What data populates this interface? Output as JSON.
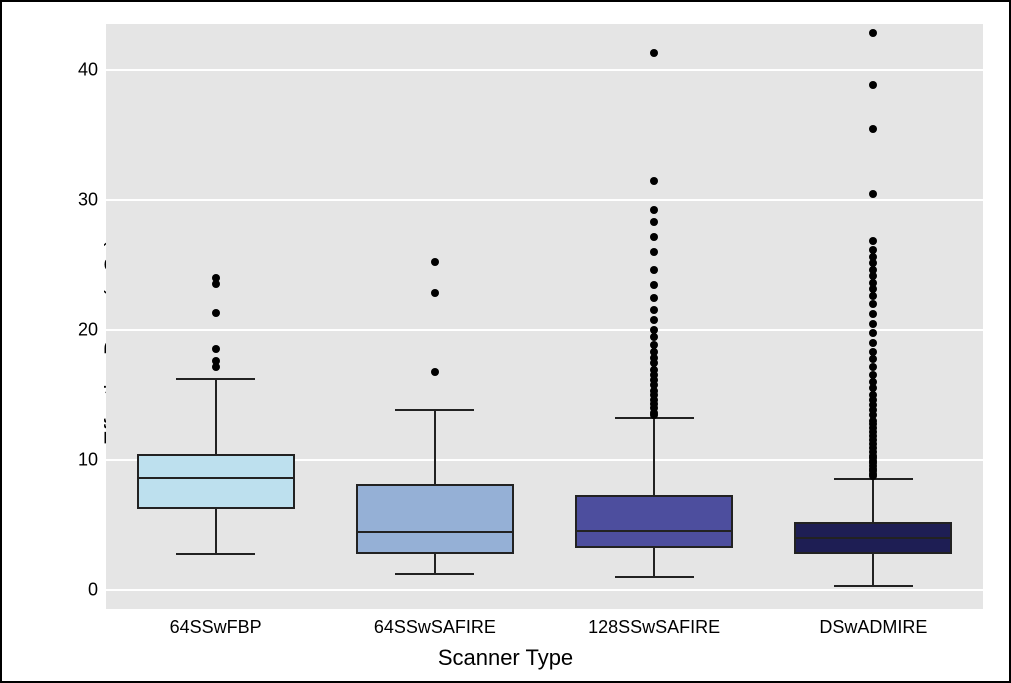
{
  "chart_data": {
    "type": "box",
    "xlabel": "Scanner Type",
    "ylabel": "Effective Dose (mSv)",
    "ylim": [
      -1.5,
      43.5
    ],
    "yticks": [
      0,
      10,
      20,
      30,
      40
    ],
    "categories": [
      "64SSwFBP",
      "64SSwSAFIRE",
      "128SSwSAFIRE",
      "DSwADMIRE"
    ],
    "box_half_width_frac": 0.09,
    "fills": [
      "#bde0ee",
      "#95b0d6",
      "#4d4e9e",
      "#1e1e54"
    ],
    "series": [
      {
        "name": "64SSwFBP",
        "q1": 6.2,
        "median": 8.6,
        "q3": 10.4,
        "whisker_low": 2.7,
        "whisker_high": 16.2,
        "outliers": [
          17.1,
          17.6,
          18.5,
          21.3,
          23.5,
          24.0
        ]
      },
      {
        "name": "64SSwSAFIRE",
        "q1": 2.7,
        "median": 4.4,
        "q3": 8.1,
        "whisker_low": 1.2,
        "whisker_high": 13.8,
        "outliers": [
          16.7,
          22.8,
          25.2
        ]
      },
      {
        "name": "128SSwSAFIRE",
        "q1": 3.2,
        "median": 4.5,
        "q3": 7.3,
        "whisker_low": 1.0,
        "whisker_high": 13.2,
        "outliers": [
          13.4,
          13.6,
          14.0,
          14.3,
          14.6,
          15.0,
          15.3,
          15.7,
          16.1,
          16.5,
          16.9,
          17.4,
          17.8,
          18.3,
          18.8,
          19.4,
          20.0,
          20.7,
          21.5,
          22.4,
          23.4,
          24.6,
          26.0,
          27.1,
          28.3,
          29.2,
          31.4,
          41.3
        ]
      },
      {
        "name": "DSwADMIRE",
        "q1": 2.7,
        "median": 4.0,
        "q3": 5.2,
        "whisker_low": 0.3,
        "whisker_high": 8.5,
        "outliers": [
          8.7,
          8.9,
          9.1,
          9.3,
          9.5,
          9.7,
          9.9,
          10.1,
          10.3,
          10.6,
          10.9,
          11.2,
          11.5,
          11.8,
          12.1,
          12.4,
          12.7,
          13.0,
          13.4,
          13.8,
          14.2,
          14.6,
          15.0,
          15.5,
          16.0,
          16.5,
          17.1,
          17.7,
          18.3,
          19.0,
          19.7,
          20.4,
          21.2,
          22.0,
          22.6,
          23.1,
          23.6,
          24.1,
          24.6,
          25.1,
          25.6,
          26.1,
          26.8,
          30.4,
          35.4,
          38.8,
          42.8
        ]
      }
    ]
  }
}
